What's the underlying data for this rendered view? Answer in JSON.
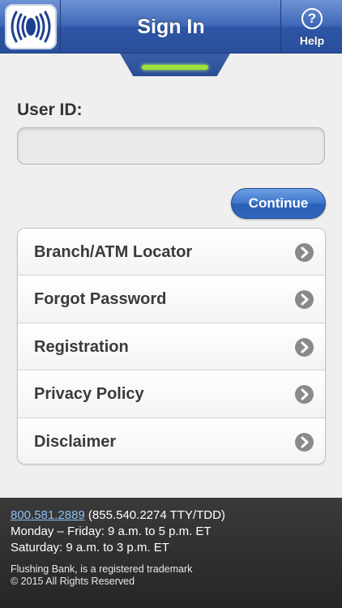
{
  "header": {
    "title": "Sign In",
    "help_label": "Help",
    "help_glyph": "?",
    "logo_icon": "bank-logo-icon"
  },
  "progress": {
    "fraction": 1.0,
    "color": "#9be23a"
  },
  "form": {
    "userid_label": "User ID:",
    "userid_value": "",
    "userid_placeholder": "",
    "continue_label": "Continue"
  },
  "menu": {
    "items": [
      {
        "label": "Branch/ATM Locator",
        "icon": "chevron-right-icon"
      },
      {
        "label": "Forgot Password",
        "icon": "chevron-right-icon"
      },
      {
        "label": "Registration",
        "icon": "chevron-right-icon"
      },
      {
        "label": "Privacy Policy",
        "icon": "chevron-right-icon"
      },
      {
        "label": "Disclaimer",
        "icon": "chevron-right-icon"
      }
    ]
  },
  "footer": {
    "phone": "800.581.2889",
    "tty": " (855.540.2274 TTY/TDD)",
    "hours_weekday": "Monday – Friday: 9 a.m. to 5 p.m. ET",
    "hours_saturday": "Saturday: 9 a.m. to 3 p.m. ET",
    "trademark": "Flushing Bank, is a registered trademark",
    "copyright": "© 2015 All Rights Reserved"
  },
  "colors": {
    "header_blue": "#3f68b8",
    "accent_blue": "#3b74c8",
    "link_blue": "#8ec0f3",
    "footer_bg": "#2f2f2f"
  }
}
